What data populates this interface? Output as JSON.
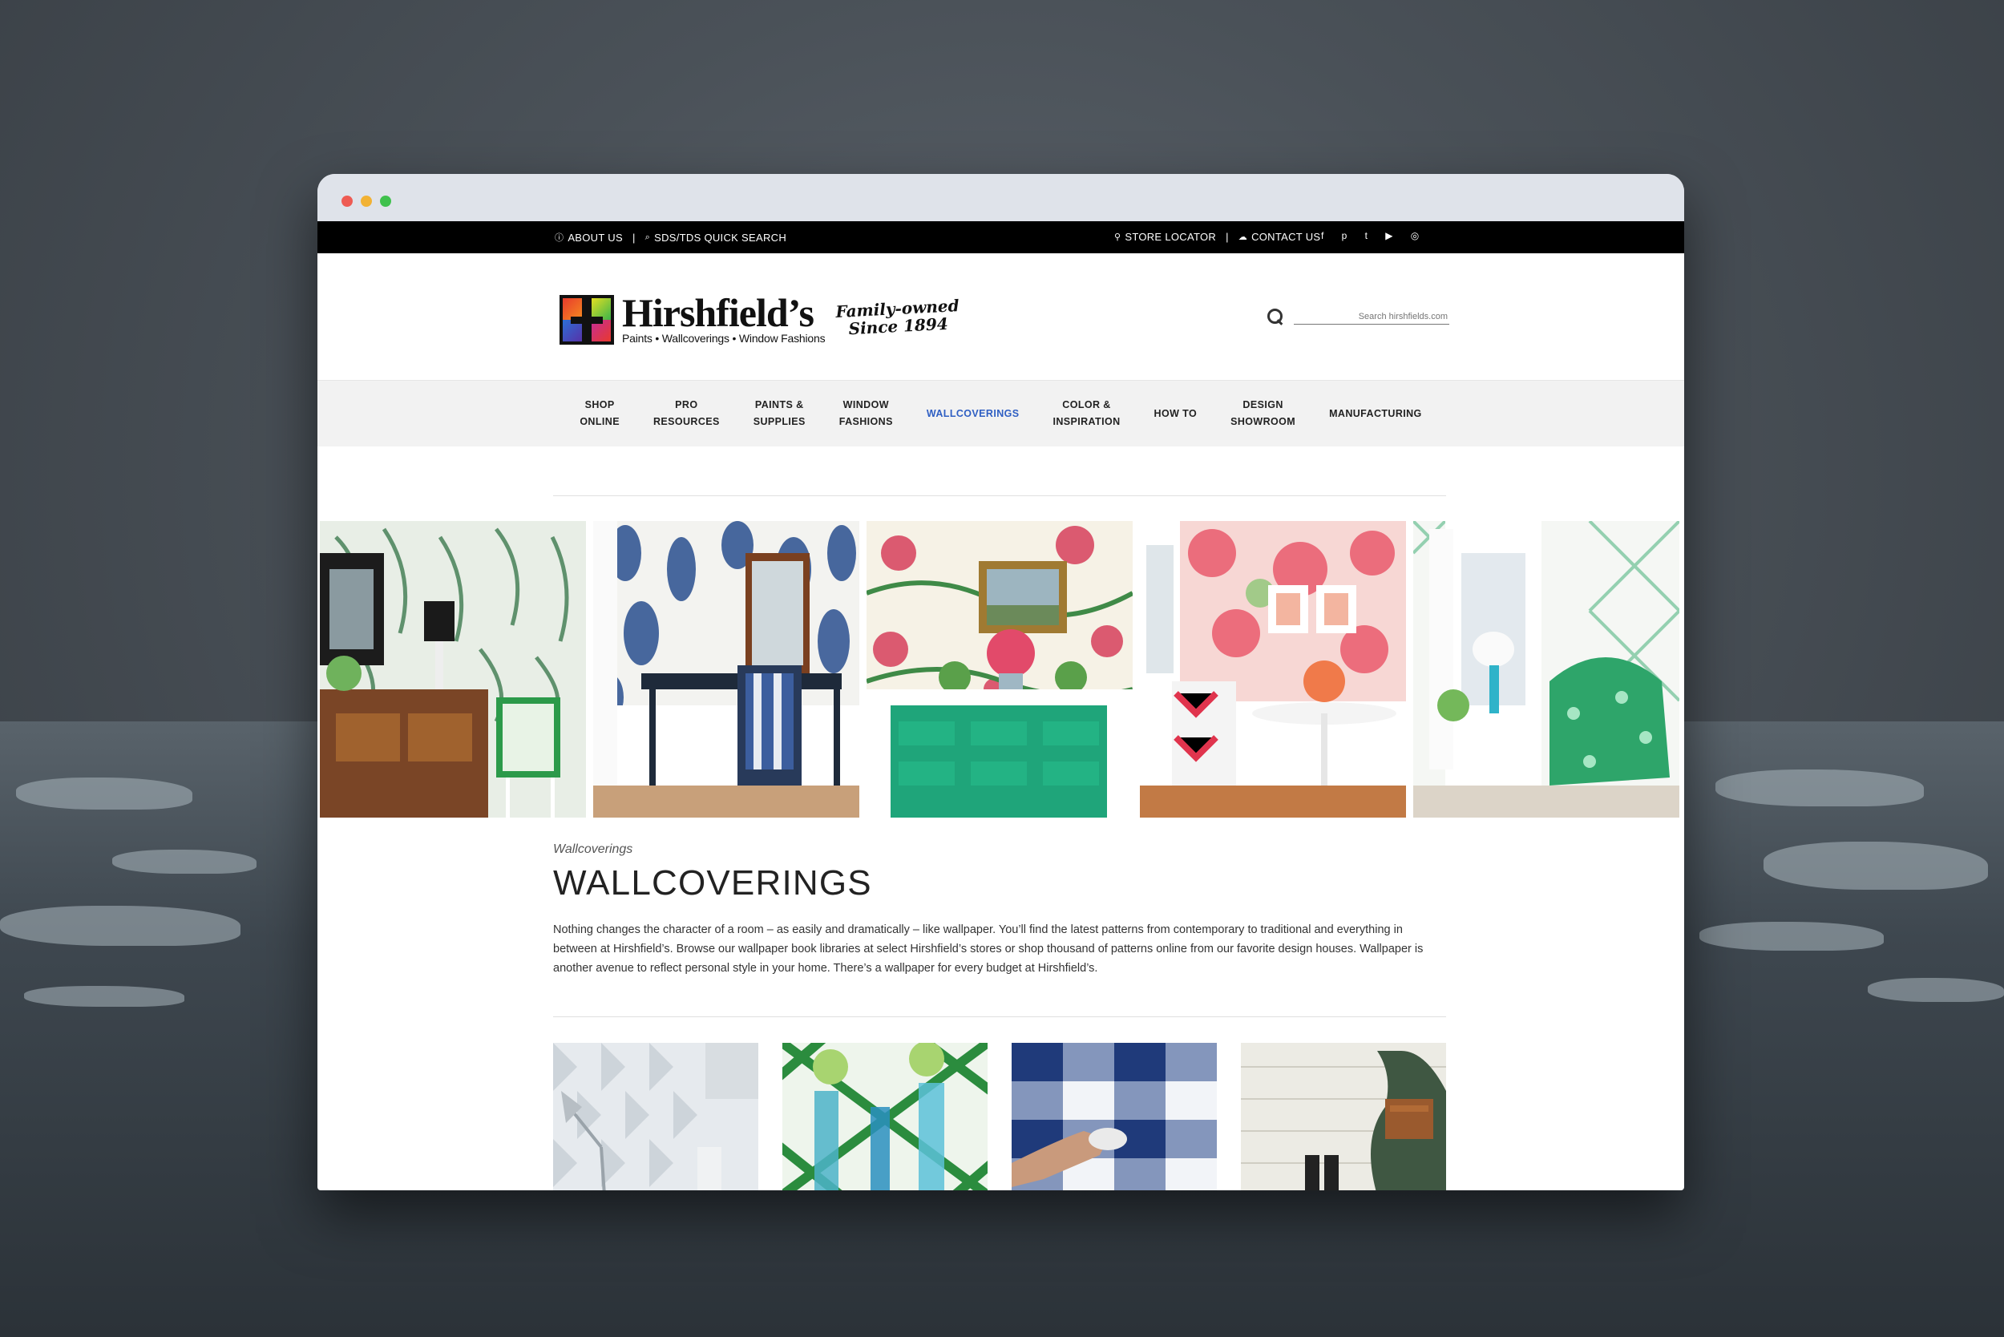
{
  "topbar": {
    "about": "ABOUT US",
    "sds": "SDS/TDS QUICK SEARCH",
    "store": "STORE LOCATOR",
    "contact": "CONTACT US",
    "separator": "|",
    "social": [
      {
        "icon": "facebook-icon",
        "glyph": "f"
      },
      {
        "icon": "pinterest-icon",
        "glyph": "p"
      },
      {
        "icon": "twitter-icon",
        "glyph": "t"
      },
      {
        "icon": "youtube-icon",
        "glyph": "▶"
      },
      {
        "icon": "instagram-icon",
        "glyph": "◎"
      }
    ]
  },
  "header": {
    "logo_name": "Hirshfield’s",
    "logo_tagline": "Paints • Wallcoverings • Window Fashions",
    "family_line1": "Family-owned",
    "family_line2": "Since 1894",
    "search_placeholder": "Search hirshfields.com"
  },
  "nav": {
    "items": [
      {
        "label": "SHOP\nONLINE",
        "active": false
      },
      {
        "label": "PRO\nRESOURCES",
        "active": false
      },
      {
        "label": "PAINTS &\nSUPPLIES",
        "active": false
      },
      {
        "label": "WINDOW\nFASHIONS",
        "active": false
      },
      {
        "label": "WALLCOVERINGS",
        "active": true
      },
      {
        "label": "COLOR &\nINSPIRATION",
        "active": false
      },
      {
        "label": "HOW TO",
        "active": false
      },
      {
        "label": "DESIGN\nSHOWROOM",
        "active": false
      },
      {
        "label": "MANUFACTURING",
        "active": false
      }
    ],
    "active_color": "#2f5fc3"
  },
  "main": {
    "breadcrumb": "Wallcoverings",
    "title": "WALLCOVERINGS",
    "intro": "Nothing changes the character of a room – as easily and dramatically – like wallpaper. You’ll find the latest patterns from contemporary to traditional and everything in between at Hirshfield’s. Browse our wallpaper book libraries at select Hirshfield’s stores or shop thousand of patterns online from our favorite design houses. Wallpaper is another avenue to reflect personal style in your home. There’s a wallpaper for every budget at Hirshfield’s."
  }
}
